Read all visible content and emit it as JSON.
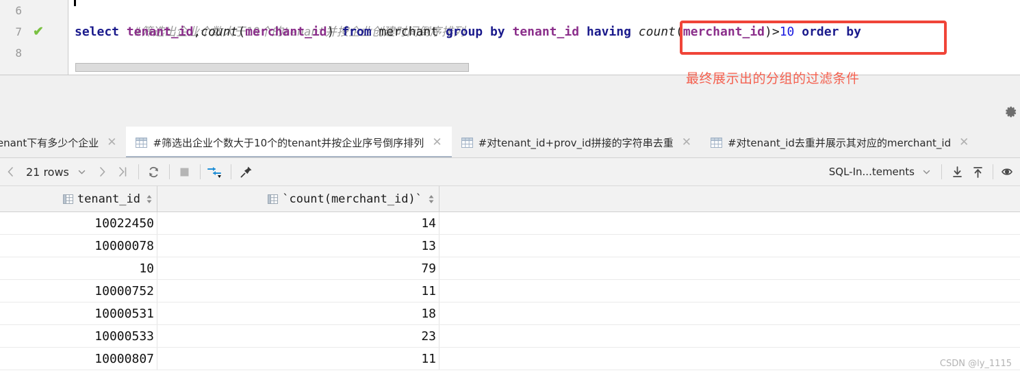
{
  "editor": {
    "lines": [
      {
        "num": "6",
        "checked": false
      },
      {
        "num": "7",
        "checked": true
      },
      {
        "num": "8",
        "checked": false
      }
    ],
    "comment_line": "#筛选出企业个数大于10个的tenant并按企业创建时间倒序排列",
    "sql_tokens": [
      {
        "text": "select",
        "kind": "kw"
      },
      {
        "text": " ",
        "kind": "plain"
      },
      {
        "text": "tenant_id",
        "kind": "id"
      },
      {
        "text": ",",
        "kind": "punc"
      },
      {
        "text": "count",
        "kind": "fn"
      },
      {
        "text": "(",
        "kind": "punc"
      },
      {
        "text": "merchant_id",
        "kind": "id"
      },
      {
        "text": ")",
        "kind": "punc"
      },
      {
        "text": " ",
        "kind": "plain"
      },
      {
        "text": "from",
        "kind": "kw"
      },
      {
        "text": " merchant ",
        "kind": "plain"
      },
      {
        "text": "group",
        "kind": "kw"
      },
      {
        "text": " ",
        "kind": "plain"
      },
      {
        "text": "by",
        "kind": "kw"
      },
      {
        "text": " ",
        "kind": "plain"
      },
      {
        "text": "tenant_id",
        "kind": "id"
      },
      {
        "text": " ",
        "kind": "plain"
      },
      {
        "text": "having",
        "kind": "kw"
      },
      {
        "text": " ",
        "kind": "plain"
      },
      {
        "text": "count",
        "kind": "fn"
      },
      {
        "text": "(",
        "kind": "punc"
      },
      {
        "text": "merchant_id",
        "kind": "id"
      },
      {
        "text": ")>",
        "kind": "punc"
      },
      {
        "text": "10",
        "kind": "num"
      },
      {
        "text": " ",
        "kind": "plain"
      },
      {
        "text": "order",
        "kind": "kw"
      },
      {
        "text": " ",
        "kind": "plain"
      },
      {
        "text": "by",
        "kind": "kw"
      }
    ]
  },
  "annotation": {
    "text": "最终展示出的分组的过滤条件",
    "color": "#f4604f",
    "box_color": "#f04438"
  },
  "tabs": [
    {
      "label": "tenant下有多少个企业",
      "active": false,
      "icon": false,
      "truncated_left": true
    },
    {
      "label": "#筛选出企业个数大于10个的tenant并按企业序号倒序排列",
      "active": true,
      "icon": true
    },
    {
      "label": "#对tenant_id+prov_id拼接的字符串去重",
      "active": false,
      "icon": true
    },
    {
      "label": "#对tenant_id去重并展示其对应的merchant_id",
      "active": false,
      "icon": true
    }
  ],
  "toolbar": {
    "rows_label": "21 rows",
    "prev_icon": "chevron-left-icon",
    "next_icon": "chevron-right-icon",
    "last_icon": "last-page-icon",
    "dropdown_icon": "chevron-down-icon",
    "refresh_icon": "refresh-icon",
    "stop_icon": "stop-icon",
    "transpose_icon": "transpose-icon",
    "pin_icon": "pin-icon",
    "mode_label": "SQL-In...tements",
    "import_icon": "download-icon",
    "export_icon": "upload-icon",
    "view_icon": "eye-icon"
  },
  "table": {
    "columns": [
      {
        "name": "tenant_id",
        "icon": "column-icon",
        "sort": "sort-icon"
      },
      {
        "name": "`count(merchant_id)`",
        "icon": "column-icon",
        "sort": "sort-icon"
      }
    ],
    "rows": [
      {
        "tenant_id": "10022450",
        "count": "14"
      },
      {
        "tenant_id": "10000078",
        "count": "13"
      },
      {
        "tenant_id": "10",
        "count": "79"
      },
      {
        "tenant_id": "10000752",
        "count": "11"
      },
      {
        "tenant_id": "10000531",
        "count": "18"
      },
      {
        "tenant_id": "10000533",
        "count": "23"
      },
      {
        "tenant_id": "10000807",
        "count": "11"
      }
    ]
  },
  "watermark": "CSDN @ly_1115"
}
